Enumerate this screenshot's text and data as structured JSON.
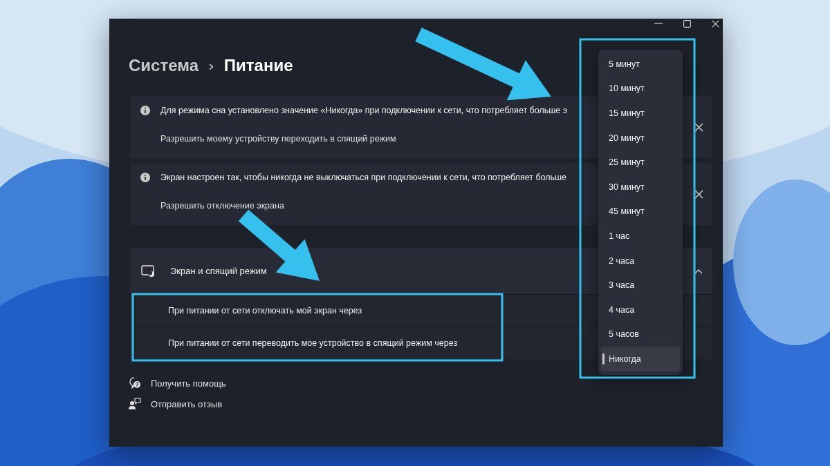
{
  "breadcrumb": {
    "parent": "Система",
    "separator": "›",
    "current": "Питание"
  },
  "notices": [
    {
      "text": "Для режима сна установлено значение «Никогда» при подключении к сети, что потребляет больше э",
      "action": "Разрешить моему устройству переходить в спящий режим"
    },
    {
      "text": "Экран настроен так, чтобы никогда не выключаться при подключении к сети, что потребляет больше",
      "action": "Разрешить отключение экрана"
    }
  ],
  "screen_sleep": {
    "title": "Экран и спящий режим",
    "expanded": true,
    "rows": [
      {
        "label": "При питании от сети отключать мой экран через"
      },
      {
        "label": "При питании от сети переводить мое устройство в спящий режим через"
      }
    ]
  },
  "help_links": [
    {
      "kind": "help",
      "label": "Получить помощь"
    },
    {
      "kind": "feedback",
      "label": "Отправить отзыв"
    }
  ],
  "dropdown": {
    "options": [
      {
        "label": "5 минут",
        "selected": false
      },
      {
        "label": "10 минут",
        "selected": false
      },
      {
        "label": "15 минут",
        "selected": false
      },
      {
        "label": "20 минут",
        "selected": false
      },
      {
        "label": "25 минут",
        "selected": false
      },
      {
        "label": "30 минут",
        "selected": false
      },
      {
        "label": "45 минут",
        "selected": false
      },
      {
        "label": "1 час",
        "selected": false
      },
      {
        "label": "2 часа",
        "selected": false
      },
      {
        "label": "3 часа",
        "selected": false
      },
      {
        "label": "4 часа",
        "selected": false
      },
      {
        "label": "5 часов",
        "selected": false
      },
      {
        "label": "Никогда",
        "selected": true
      }
    ]
  }
}
